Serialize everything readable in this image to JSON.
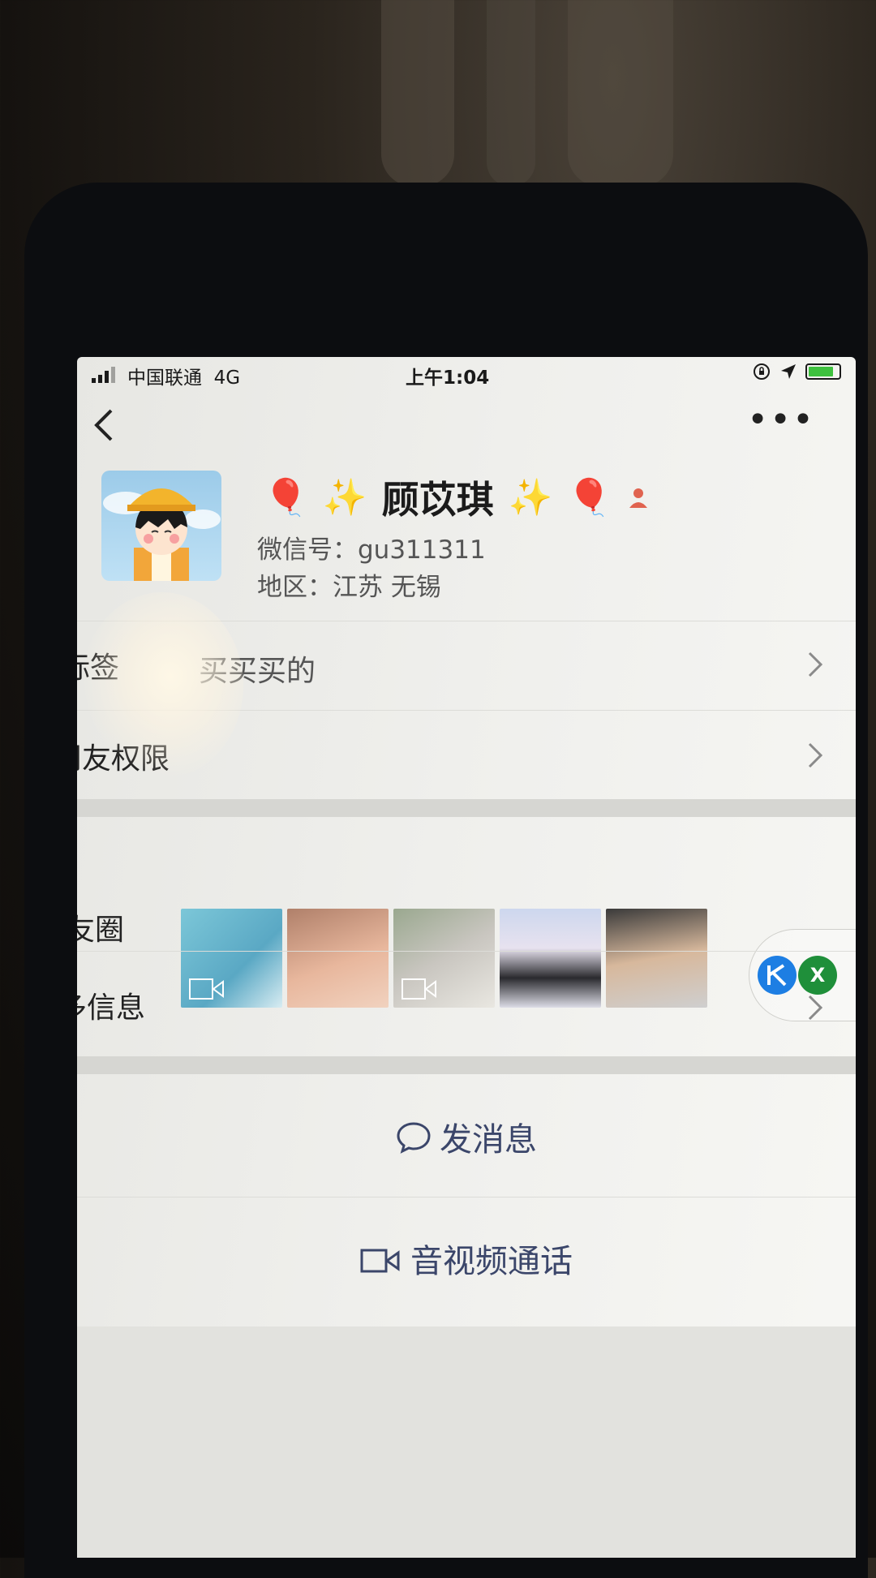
{
  "status_bar": {
    "carrier": "中国联通",
    "network": "4G",
    "time": "上午1:04"
  },
  "profile": {
    "name": "顾苡琪",
    "wechat_id": "微信号：gu311311",
    "region": "地区：江苏 无锡",
    "name_emojis_left": [
      "🎈",
      "✨"
    ],
    "name_emojis_right": [
      "✨",
      "🎈"
    ]
  },
  "rows": {
    "tags_label": "标签",
    "tags_value": "买买买的",
    "permissions_label": "朋友权限",
    "moments_label": "朋友圈",
    "more_info_label": "更多信息"
  },
  "actions": {
    "send_message": "发消息",
    "av_call": "音视频通话"
  },
  "floating_chip": {
    "letter_x": "X"
  },
  "colors": {
    "action_text": "#3b466a",
    "battery": "#3ec13e"
  }
}
